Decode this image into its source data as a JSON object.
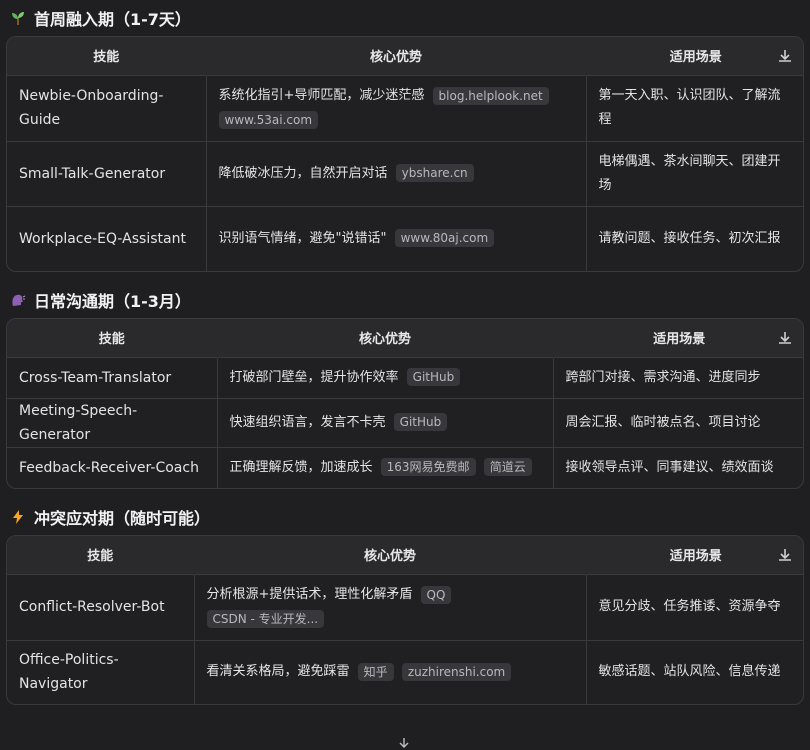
{
  "sections": [
    {
      "title": "首周融入期（1-7天）",
      "icon": "seedling-icon",
      "headers": [
        "技能",
        "核心优势",
        "适用场景"
      ],
      "rows": [
        {
          "name": "Newbie-Onboarding-Guide",
          "advantage": "系统化指引+导师匹配，减少迷茫感",
          "tags": [
            "blog.helplook.net",
            "www.53ai.com"
          ],
          "scene": "第一天入职、认识团队、了解流程"
        },
        {
          "name": "Small-Talk-Generator",
          "advantage": "降低破冰压力，自然开启对话",
          "tags": [
            "ybshare.cn"
          ],
          "scene": "电梯偶遇、茶水间聊天、团建开场"
        },
        {
          "name": "Workplace-EQ-Assistant",
          "advantage": "识别语气情绪，避免\"说错话\"",
          "tags": [
            "www.80aj.com"
          ],
          "scene": "请教问题、接收任务、初次汇报"
        }
      ]
    },
    {
      "title": "日常沟通期（1-3月）",
      "icon": "speaking-head-icon",
      "headers": [
        "技能",
        "核心优势",
        "适用场景"
      ],
      "rows": [
        {
          "name": "Cross-Team-Translator",
          "advantage": "打破部门壁垒，提升协作效率",
          "tags": [
            "GitHub"
          ],
          "scene": "跨部门对接、需求沟通、进度同步"
        },
        {
          "name": "Meeting-Speech-Generator",
          "advantage": "快速组织语言，发言不卡壳",
          "tags": [
            "GitHub"
          ],
          "scene": "周会汇报、临时被点名、项目讨论"
        },
        {
          "name": "Feedback-Receiver-Coach",
          "advantage": "正确理解反馈，加速成长",
          "tags": [
            "163网易免费邮",
            "简道云"
          ],
          "scene": "接收领导点评、同事建议、绩效面谈"
        }
      ]
    },
    {
      "title": "冲突应对期（随时可能）",
      "icon": "lightning-icon",
      "headers": [
        "技能",
        "核心优势",
        "适用场景"
      ],
      "rows": [
        {
          "name": "Conflict-Resolver-Bot",
          "advantage": "分析根源+提供话术，理性化解矛盾",
          "tags": [
            "QQ",
            "CSDN - 专业开发..."
          ],
          "scene": "意见分歧、任务推诿、资源争夺"
        },
        {
          "name": "Office-Politics-Navigator",
          "advantage": "看清关系格局，避免踩雷",
          "tags": [
            "知乎",
            "zuzhirenshi.com"
          ],
          "scene": "敏感话题、站队风险、信息传递"
        }
      ]
    }
  ]
}
